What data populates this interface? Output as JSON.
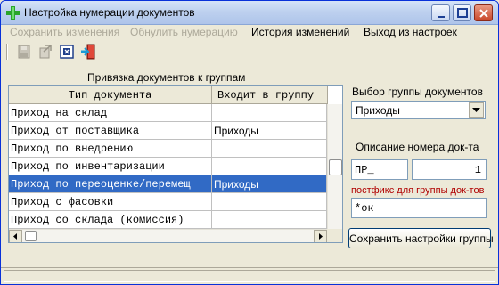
{
  "window": {
    "title": "Настройка нумерации документов"
  },
  "menu": {
    "items": [
      {
        "label": "Сохранить изменения",
        "enabled": false
      },
      {
        "label": "Обнулить нумерацию",
        "enabled": false
      },
      {
        "label": "История изменений",
        "enabled": true
      },
      {
        "label": "Выход из настроек",
        "enabled": true
      }
    ]
  },
  "toolbar": {
    "icons": [
      "save-icon",
      "reset-icon",
      "history-icon",
      "exit-icon"
    ]
  },
  "groups_panel": {
    "title": "Привязка документов к группам",
    "columns": [
      "Тип документа",
      "Входит в группу"
    ],
    "rows": [
      {
        "type": "Приход на склад",
        "group": ""
      },
      {
        "type": "Приход от поставщика",
        "group": "Приходы"
      },
      {
        "type": "Приход по внедрению",
        "group": ""
      },
      {
        "type": "Приход по инвентаризации",
        "group": ""
      },
      {
        "type": "Приход по переоценке/перемещ",
        "group": "Приходы",
        "selected": true
      },
      {
        "type": "Приход с фасовки",
        "group": ""
      },
      {
        "type": "Приход со склада (комиссия)",
        "group": ""
      }
    ]
  },
  "right_panel": {
    "group_select_label": "Выбор группы документов",
    "group_selected": "Приходы",
    "number_desc_label": "Описание номера док-та",
    "prefix_value": "ПР_",
    "counter_value": "1",
    "postfix_label": "постфикс для группы док-тов",
    "postfix_value": "*ок",
    "save_button": "Сохранить настройки группы"
  },
  "colors": {
    "selection": "#316ac5",
    "postfix_label": "#b00000",
    "title_gradient": "#bed1ef"
  }
}
